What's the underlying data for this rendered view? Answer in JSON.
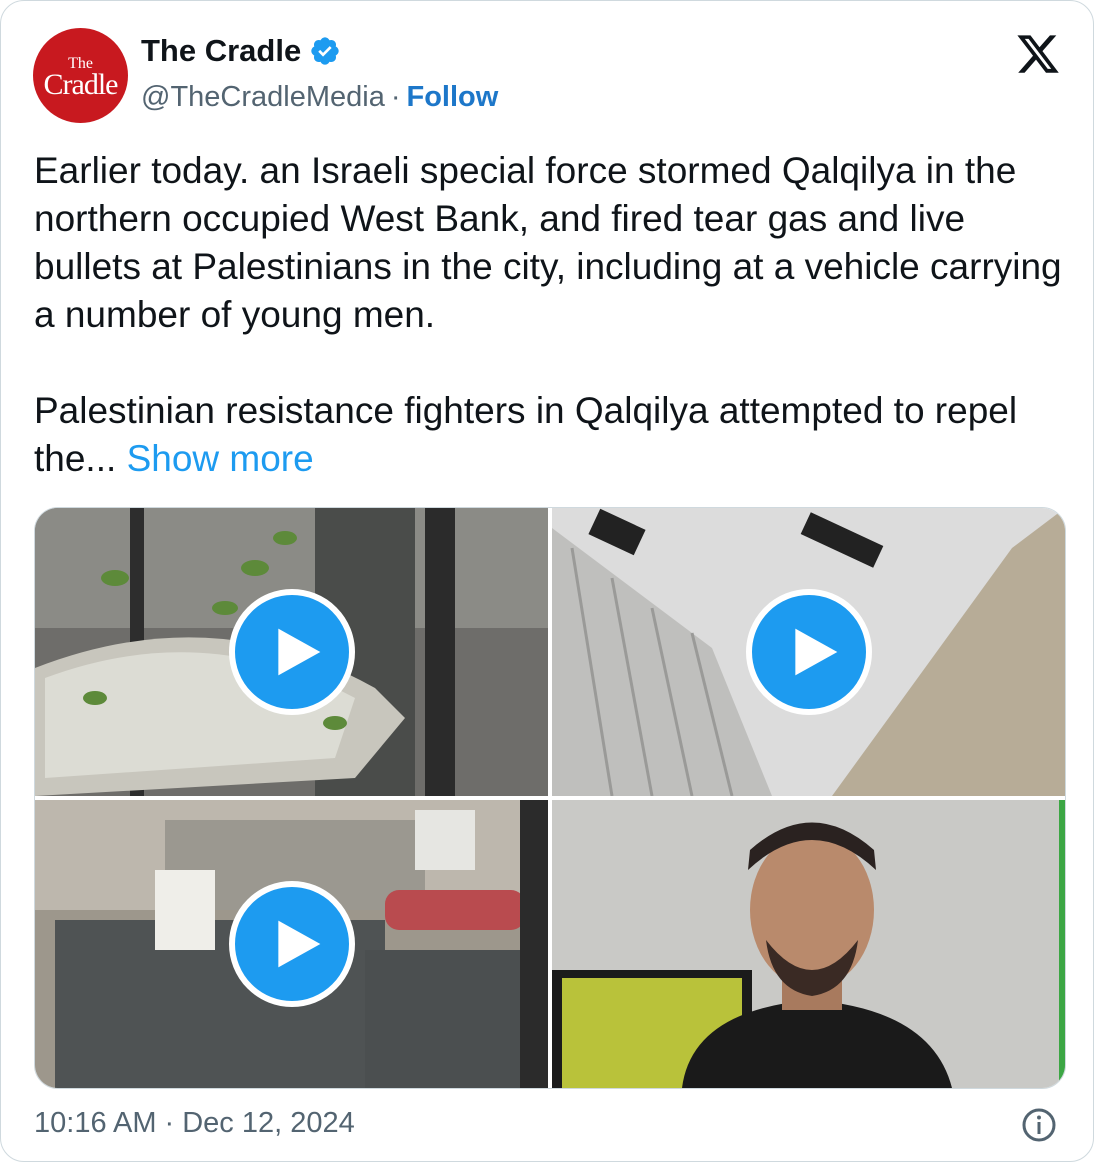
{
  "author": {
    "name": "The Cradle",
    "handle": "@TheCradleMedia",
    "separator": "·",
    "follow_label": "Follow",
    "avatar_text_top": "The",
    "avatar_text_bottom": "Cradle",
    "avatar_color": "#c8191f",
    "verified_icon": "verified-badge-icon"
  },
  "platform_icon": "x-logo-icon",
  "tweet": {
    "text": "Earlier today. an Israeli special force stormed Qalqilya in the northern occupied West Bank, and fired tear gas and live bullets at Palestinians in the city, including at a vehicle carrying a number of young men.\n\nPalestinian resistance fighters in Qalqilya attempted to repel the... ",
    "show_more_label": "Show more"
  },
  "media": [
    {
      "type": "video",
      "icon": "play-icon"
    },
    {
      "type": "video",
      "icon": "play-icon"
    },
    {
      "type": "video",
      "icon": "play-icon"
    },
    {
      "type": "image"
    }
  ],
  "footer": {
    "time": "10:16 AM",
    "separator": "·",
    "date": "Dec 12, 2024",
    "info_icon": "info-icon"
  },
  "colors": {
    "accent": "#1d9bf0",
    "follow": "#1d77c9",
    "muted": "#536471",
    "text": "#0f1419"
  }
}
